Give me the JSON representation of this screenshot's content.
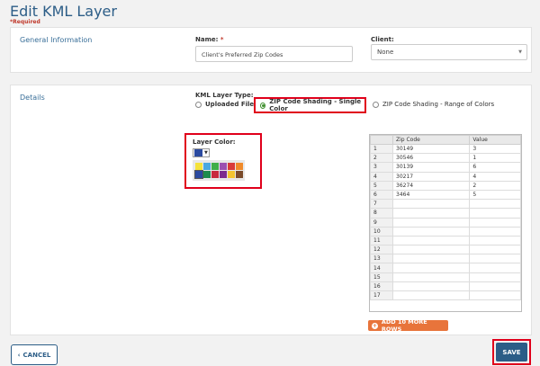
{
  "page": {
    "title": "Edit KML Layer",
    "required_note": "*Required"
  },
  "general": {
    "section_title": "General Information",
    "name_label": "Name:",
    "name_required_star": "*",
    "name_value": "Client's Preferred Zip Codes",
    "client_label": "Client:",
    "client_value": "None"
  },
  "details": {
    "section_title": "Details",
    "layer_type_label": "KML Layer Type:",
    "options": [
      {
        "label": "Uploaded File",
        "selected": false
      },
      {
        "label": "ZIP Code Shading - Single Color",
        "selected": true
      },
      {
        "label": "ZIP Code Shading - Range of Colors",
        "selected": false
      }
    ],
    "layer_color_label": "Layer Color:",
    "current_color": "#2b4aa0",
    "palette_row1": [
      "#f5e23a",
      "#4aa8e0",
      "#3fae49",
      "#9b4fb0",
      "#d93a3a",
      "#f08a2a"
    ],
    "palette_row2": [
      "#2b4aa0",
      "#1e8c4c",
      "#c8283e",
      "#7d2c8e",
      "#f4c430",
      "#7a4b2a"
    ],
    "grid": {
      "headers": [
        "",
        "Zip Code",
        "Value"
      ],
      "rows": [
        [
          "1",
          "30149",
          "3"
        ],
        [
          "2",
          "30546",
          "1"
        ],
        [
          "3",
          "30139",
          "6"
        ],
        [
          "4",
          "30217",
          "4"
        ],
        [
          "5",
          "36274",
          "2"
        ],
        [
          "6",
          "3464",
          "5"
        ],
        [
          "7",
          "",
          ""
        ],
        [
          "8",
          "",
          ""
        ],
        [
          "9",
          "",
          ""
        ],
        [
          "10",
          "",
          ""
        ],
        [
          "11",
          "",
          ""
        ],
        [
          "12",
          "",
          ""
        ],
        [
          "13",
          "",
          ""
        ],
        [
          "14",
          "",
          ""
        ],
        [
          "15",
          "",
          ""
        ],
        [
          "16",
          "",
          ""
        ],
        [
          "17",
          "",
          ""
        ]
      ]
    },
    "add_rows_label": "ADD 10 MORE ROWS"
  },
  "footer": {
    "cancel_label": "CANCEL",
    "save_label": "SAVE"
  },
  "colors": {
    "accent": "#2c5d87",
    "highlight": "#e0001b",
    "add_button": "#e8743b"
  }
}
